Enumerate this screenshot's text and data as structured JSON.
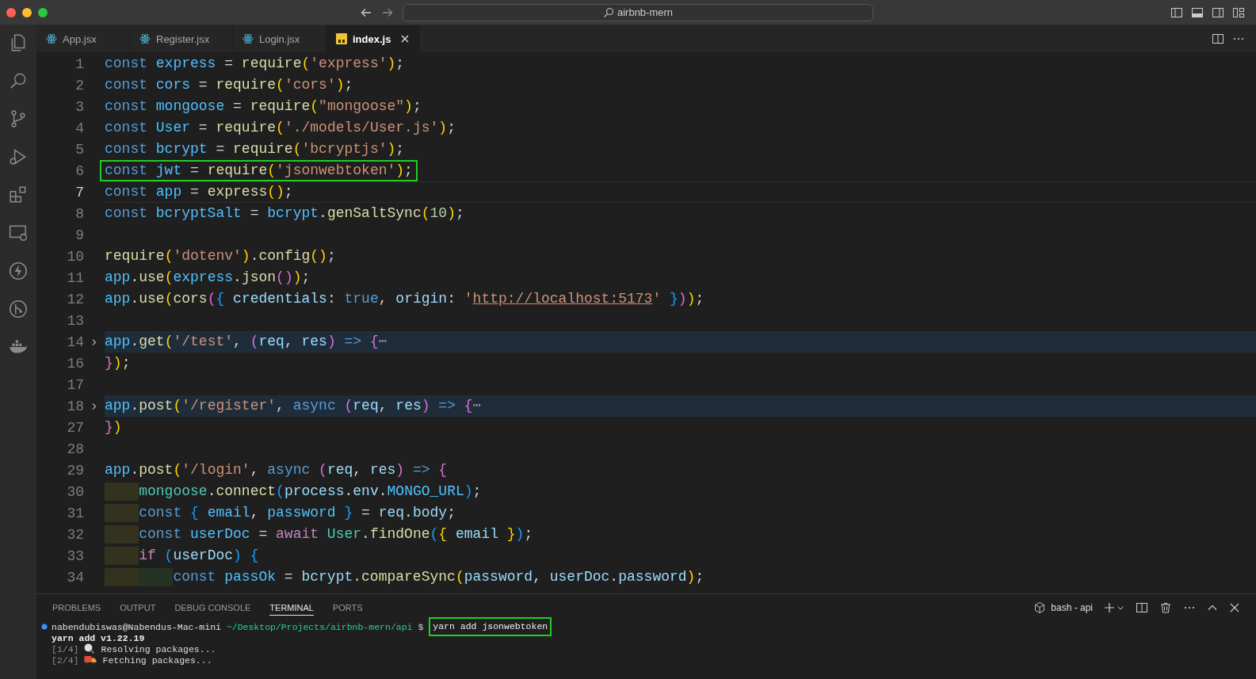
{
  "window": {
    "title": "airbnb-mern"
  },
  "tabs": [
    {
      "label": "App.jsx",
      "kind": "react",
      "selected": false
    },
    {
      "label": "Register.jsx",
      "kind": "react",
      "selected": false
    },
    {
      "label": "Login.jsx",
      "kind": "react",
      "selected": false
    },
    {
      "label": "index.js",
      "kind": "js",
      "selected": true
    }
  ],
  "editor": {
    "lines": [
      {
        "number": "1",
        "tokens": [
          {
            "kind": "k",
            "text": "const "
          },
          {
            "kind": "c",
            "text": "express"
          },
          {
            "kind": "p",
            "text": " = "
          },
          {
            "kind": "f",
            "text": "require"
          },
          {
            "kind": "b1",
            "text": "("
          },
          {
            "kind": "s",
            "text": "'express'"
          },
          {
            "kind": "b1",
            "text": ")"
          },
          {
            "kind": "p",
            "text": ";"
          }
        ]
      },
      {
        "number": "2",
        "tokens": [
          {
            "kind": "k",
            "text": "const "
          },
          {
            "kind": "c",
            "text": "cors"
          },
          {
            "kind": "p",
            "text": " = "
          },
          {
            "kind": "f",
            "text": "require"
          },
          {
            "kind": "b1",
            "text": "("
          },
          {
            "kind": "s",
            "text": "'cors'"
          },
          {
            "kind": "b1",
            "text": ")"
          },
          {
            "kind": "p",
            "text": ";"
          }
        ]
      },
      {
        "number": "3",
        "tokens": [
          {
            "kind": "k",
            "text": "const "
          },
          {
            "kind": "c",
            "text": "mongoose"
          },
          {
            "kind": "p",
            "text": " = "
          },
          {
            "kind": "f",
            "text": "require"
          },
          {
            "kind": "b1",
            "text": "("
          },
          {
            "kind": "s",
            "text": "\"mongoose\""
          },
          {
            "kind": "b1",
            "text": ")"
          },
          {
            "kind": "p",
            "text": ";"
          }
        ]
      },
      {
        "number": "4",
        "tokens": [
          {
            "kind": "k",
            "text": "const "
          },
          {
            "kind": "c",
            "text": "User"
          },
          {
            "kind": "p",
            "text": " = "
          },
          {
            "kind": "f",
            "text": "require"
          },
          {
            "kind": "b1",
            "text": "("
          },
          {
            "kind": "s",
            "text": "'./models/User.js'"
          },
          {
            "kind": "b1",
            "text": ")"
          },
          {
            "kind": "p",
            "text": ";"
          }
        ]
      },
      {
        "number": "5",
        "tokens": [
          {
            "kind": "k",
            "text": "const "
          },
          {
            "kind": "c",
            "text": "bcrypt"
          },
          {
            "kind": "p",
            "text": " = "
          },
          {
            "kind": "f",
            "text": "require"
          },
          {
            "kind": "b1",
            "text": "("
          },
          {
            "kind": "s",
            "text": "'bcryptjs'"
          },
          {
            "kind": "b1",
            "text": ")"
          },
          {
            "kind": "p",
            "text": ";"
          }
        ]
      },
      {
        "number": "6",
        "boxed": true,
        "tokens": [
          {
            "kind": "k",
            "text": "const "
          },
          {
            "kind": "c",
            "text": "jwt"
          },
          {
            "kind": "p",
            "text": " = "
          },
          {
            "kind": "f",
            "text": "require"
          },
          {
            "kind": "b1",
            "text": "("
          },
          {
            "kind": "s",
            "text": "'jsonwebtoken'"
          },
          {
            "kind": "b1",
            "text": ")"
          },
          {
            "kind": "p",
            "text": ";"
          }
        ]
      },
      {
        "number": "7",
        "current": true,
        "tokens": [
          {
            "kind": "k",
            "text": "const "
          },
          {
            "kind": "c",
            "text": "app"
          },
          {
            "kind": "p",
            "text": " = "
          },
          {
            "kind": "f",
            "text": "express"
          },
          {
            "kind": "b1",
            "text": "()"
          },
          {
            "kind": "p",
            "text": ";"
          }
        ]
      },
      {
        "number": "8",
        "tokens": [
          {
            "kind": "k",
            "text": "const "
          },
          {
            "kind": "c",
            "text": "bcryptSalt"
          },
          {
            "kind": "p",
            "text": " = "
          },
          {
            "kind": "c",
            "text": "bcrypt"
          },
          {
            "kind": "p",
            "text": "."
          },
          {
            "kind": "f",
            "text": "genSaltSync"
          },
          {
            "kind": "b1",
            "text": "("
          },
          {
            "kind": "n",
            "text": "10"
          },
          {
            "kind": "b1",
            "text": ")"
          },
          {
            "kind": "p",
            "text": ";"
          }
        ]
      },
      {
        "number": "9"
      },
      {
        "number": "10",
        "tokens": [
          {
            "kind": "f",
            "text": "require"
          },
          {
            "kind": "b1",
            "text": "("
          },
          {
            "kind": "s",
            "text": "'dotenv'"
          },
          {
            "kind": "b1",
            "text": ")"
          },
          {
            "kind": "p",
            "text": "."
          },
          {
            "kind": "f",
            "text": "config"
          },
          {
            "kind": "b1",
            "text": "()"
          },
          {
            "kind": "p",
            "text": ";"
          }
        ]
      },
      {
        "number": "11",
        "tokens": [
          {
            "kind": "c",
            "text": "app"
          },
          {
            "kind": "p",
            "text": "."
          },
          {
            "kind": "f",
            "text": "use"
          },
          {
            "kind": "b1",
            "text": "("
          },
          {
            "kind": "c",
            "text": "express"
          },
          {
            "kind": "p",
            "text": "."
          },
          {
            "kind": "f",
            "text": "json"
          },
          {
            "kind": "b2",
            "text": "()"
          },
          {
            "kind": "b1",
            "text": ")"
          },
          {
            "kind": "p",
            "text": ";"
          }
        ]
      },
      {
        "number": "12",
        "tokens": [
          {
            "kind": "c",
            "text": "app"
          },
          {
            "kind": "p",
            "text": "."
          },
          {
            "kind": "f",
            "text": "use"
          },
          {
            "kind": "b1",
            "text": "("
          },
          {
            "kind": "f",
            "text": "cors"
          },
          {
            "kind": "b2",
            "text": "("
          },
          {
            "kind": "b3",
            "text": "{ "
          },
          {
            "kind": "v",
            "text": "credentials"
          },
          {
            "kind": "p",
            "text": ": "
          },
          {
            "kind": "k",
            "text": "true"
          },
          {
            "kind": "p",
            "text": ", "
          },
          {
            "kind": "v",
            "text": "origin"
          },
          {
            "kind": "p",
            "text": ": "
          },
          {
            "kind": "s",
            "text": "'"
          },
          {
            "kind": "u",
            "text": "http://localhost:5173"
          },
          {
            "kind": "s",
            "text": "' "
          },
          {
            "kind": "b3",
            "text": "}"
          },
          {
            "kind": "b2",
            "text": ")"
          },
          {
            "kind": "b1",
            "text": ")"
          },
          {
            "kind": "p",
            "text": ";"
          }
        ]
      },
      {
        "number": "13"
      },
      {
        "number": "14",
        "folded": true,
        "tokens": [
          {
            "kind": "c",
            "text": "app"
          },
          {
            "kind": "p",
            "text": "."
          },
          {
            "kind": "f",
            "text": "get"
          },
          {
            "kind": "b1",
            "text": "("
          },
          {
            "kind": "s",
            "text": "'/test'"
          },
          {
            "kind": "p",
            "text": ", "
          },
          {
            "kind": "b2",
            "text": "("
          },
          {
            "kind": "v",
            "text": "req"
          },
          {
            "kind": "p",
            "text": ", "
          },
          {
            "kind": "v",
            "text": "res"
          },
          {
            "kind": "b2",
            "text": ")"
          },
          {
            "kind": "k",
            "text": " => "
          },
          {
            "kind": "b2",
            "text": "{"
          },
          {
            "kind": "fold",
            "text": "⋯"
          }
        ]
      },
      {
        "number": "16",
        "tokens": [
          {
            "kind": "b2",
            "text": "}"
          },
          {
            "kind": "b1",
            "text": ")"
          },
          {
            "kind": "p",
            "text": ";"
          }
        ]
      },
      {
        "number": "17"
      },
      {
        "number": "18",
        "folded": true,
        "tokens": [
          {
            "kind": "c",
            "text": "app"
          },
          {
            "kind": "p",
            "text": "."
          },
          {
            "kind": "f",
            "text": "post"
          },
          {
            "kind": "b1",
            "text": "("
          },
          {
            "kind": "s",
            "text": "'/register'"
          },
          {
            "kind": "p",
            "text": ", "
          },
          {
            "kind": "k",
            "text": "async "
          },
          {
            "kind": "b2",
            "text": "("
          },
          {
            "kind": "v",
            "text": "req"
          },
          {
            "kind": "p",
            "text": ", "
          },
          {
            "kind": "v",
            "text": "res"
          },
          {
            "kind": "b2",
            "text": ")"
          },
          {
            "kind": "k",
            "text": " => "
          },
          {
            "kind": "b2",
            "text": "{"
          },
          {
            "kind": "fold",
            "text": "⋯"
          }
        ]
      },
      {
        "number": "27",
        "tokens": [
          {
            "kind": "b2",
            "text": "}"
          },
          {
            "kind": "b1",
            "text": ")"
          }
        ]
      },
      {
        "number": "28"
      },
      {
        "number": "29",
        "tokens": [
          {
            "kind": "c",
            "text": "app"
          },
          {
            "kind": "p",
            "text": "."
          },
          {
            "kind": "f",
            "text": "post"
          },
          {
            "kind": "b1",
            "text": "("
          },
          {
            "kind": "s",
            "text": "'/login'"
          },
          {
            "kind": "p",
            "text": ", "
          },
          {
            "kind": "k",
            "text": "async "
          },
          {
            "kind": "b2",
            "text": "("
          },
          {
            "kind": "v",
            "text": "req"
          },
          {
            "kind": "p",
            "text": ", "
          },
          {
            "kind": "v",
            "text": "res"
          },
          {
            "kind": "b2",
            "text": ")"
          },
          {
            "kind": "k",
            "text": " => "
          },
          {
            "kind": "b2",
            "text": "{"
          }
        ]
      },
      {
        "number": "30",
        "tokens": [
          {
            "kind": "indent"
          },
          {
            "kind": "t",
            "text": "mongoose"
          },
          {
            "kind": "p",
            "text": "."
          },
          {
            "kind": "f",
            "text": "connect"
          },
          {
            "kind": "b3",
            "text": "("
          },
          {
            "kind": "v",
            "text": "process"
          },
          {
            "kind": "p",
            "text": "."
          },
          {
            "kind": "v",
            "text": "env"
          },
          {
            "kind": "p",
            "text": "."
          },
          {
            "kind": "c",
            "text": "MONGO_URL"
          },
          {
            "kind": "b3",
            "text": ")"
          },
          {
            "kind": "p",
            "text": ";"
          }
        ]
      },
      {
        "number": "31",
        "tokens": [
          {
            "kind": "indent"
          },
          {
            "kind": "k",
            "text": "const "
          },
          {
            "kind": "b3",
            "text": "{ "
          },
          {
            "kind": "c",
            "text": "email"
          },
          {
            "kind": "p",
            "text": ", "
          },
          {
            "kind": "c",
            "text": "password"
          },
          {
            "kind": "b3",
            "text": " }"
          },
          {
            "kind": "p",
            "text": " = "
          },
          {
            "kind": "v",
            "text": "req"
          },
          {
            "kind": "p",
            "text": "."
          },
          {
            "kind": "v",
            "text": "body"
          },
          {
            "kind": "p",
            "text": ";"
          }
        ]
      },
      {
        "number": "32",
        "tokens": [
          {
            "kind": "indent"
          },
          {
            "kind": "k",
            "text": "const "
          },
          {
            "kind": "c",
            "text": "userDoc"
          },
          {
            "kind": "p",
            "text": " = "
          },
          {
            "kind": "x",
            "text": "await "
          },
          {
            "kind": "t",
            "text": "User"
          },
          {
            "kind": "p",
            "text": "."
          },
          {
            "kind": "f",
            "text": "findOne"
          },
          {
            "kind": "b3",
            "text": "("
          },
          {
            "kind": "b1",
            "text": "{ "
          },
          {
            "kind": "v",
            "text": "email"
          },
          {
            "kind": "b1",
            "text": " }"
          },
          {
            "kind": "b3",
            "text": ")"
          },
          {
            "kind": "p",
            "text": ";"
          }
        ]
      },
      {
        "number": "33",
        "tokens": [
          {
            "kind": "indent"
          },
          {
            "kind": "x",
            "text": "if "
          },
          {
            "kind": "b3",
            "text": "("
          },
          {
            "kind": "v",
            "text": "userDoc"
          },
          {
            "kind": "b3",
            "text": ") {"
          }
        ]
      },
      {
        "number": "34",
        "tokens": [
          {
            "kind": "indent"
          },
          {
            "kind": "indent"
          },
          {
            "kind": "k",
            "text": "const "
          },
          {
            "kind": "c",
            "text": "passOk"
          },
          {
            "kind": "p",
            "text": " = "
          },
          {
            "kind": "v",
            "text": "bcrypt"
          },
          {
            "kind": "p",
            "text": "."
          },
          {
            "kind": "f",
            "text": "compareSync"
          },
          {
            "kind": "b1",
            "text": "("
          },
          {
            "kind": "v",
            "text": "password"
          },
          {
            "kind": "p",
            "text": ", "
          },
          {
            "kind": "v",
            "text": "userDoc"
          },
          {
            "kind": "p",
            "text": "."
          },
          {
            "kind": "v",
            "text": "password"
          },
          {
            "kind": "b1",
            "text": ")"
          },
          {
            "kind": "p",
            "text": ";"
          }
        ]
      }
    ]
  },
  "panel": {
    "tabs": [
      {
        "label": "PROBLEMS",
        "selected": false
      },
      {
        "label": "OUTPUT",
        "selected": false
      },
      {
        "label": "DEBUG CONSOLE",
        "selected": false
      },
      {
        "label": "TERMINAL",
        "selected": true
      },
      {
        "label": "PORTS",
        "selected": false
      }
    ],
    "terminal_name": "bash - api",
    "terminal": {
      "prompt": {
        "user": "nabendubiswas@Nabendus-Mac-mini",
        "path": "~/Desktop/Projects/airbnb-mern/api",
        "symbol": "$",
        "command": "yarn add jsonwebtoken",
        "command_boxed": true
      },
      "lines": [
        {
          "kind": "bold",
          "text": "yarn add v1.22.19"
        },
        {
          "kind": "step",
          "step": "[1/4]",
          "text": "Resolving packages..."
        },
        {
          "kind": "step",
          "step": "[2/4]",
          "text": "Fetching packages..."
        }
      ]
    }
  }
}
